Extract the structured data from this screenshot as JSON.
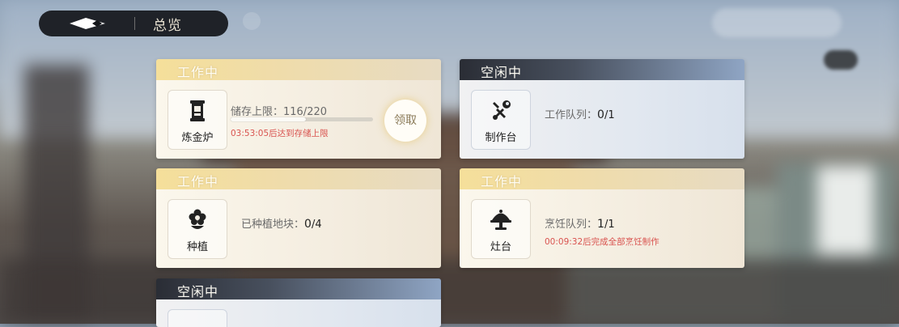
{
  "header": {
    "title": "总览"
  },
  "cards": [
    {
      "status": "工作中",
      "facility": "炼金炉",
      "icon": "hourglass-icon",
      "info_label": "储存上限：",
      "info_value": "116/220",
      "progress": 0.53,
      "warning": "03:53:05后达到存储上限",
      "action": "领取"
    },
    {
      "status": "空闲中",
      "facility": "制作台",
      "icon": "wrench-icon",
      "info_label": "工作队列：",
      "info_value_current": "0",
      "info_value_total": "/1"
    },
    {
      "status": "工作中",
      "facility": "种植",
      "icon": "flower-icon",
      "info_label": "已种植地块：",
      "info_value_current": "0",
      "info_value_total": "/4"
    },
    {
      "status": "工作中",
      "facility": "灶台",
      "icon": "cloche-icon",
      "info_label": "烹饪队列：",
      "info_value_current": "1",
      "info_value_total": "/1",
      "warning": "00:09:32后完成全部烹饪制作"
    },
    {
      "status": "空闲中"
    }
  ],
  "colors": {
    "working_header": "#f5df9a",
    "idle_header": "#2a2d35",
    "warning": "#d9534f",
    "topbar": "#14161a"
  }
}
